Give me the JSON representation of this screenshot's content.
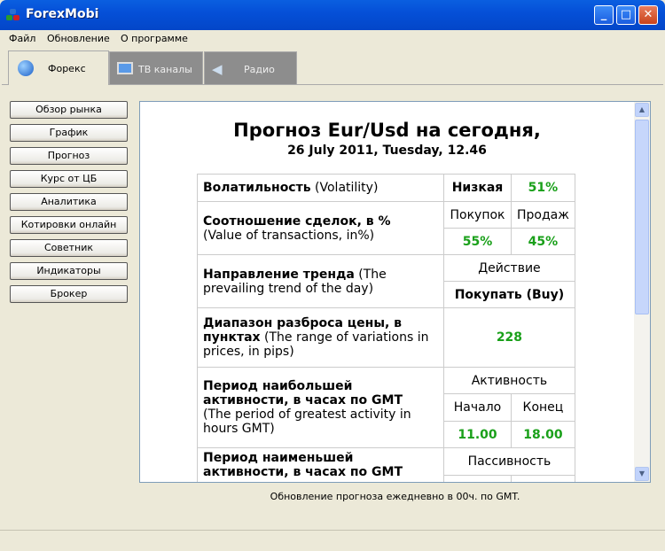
{
  "window": {
    "title": "ForexMobi",
    "minimize": "_",
    "maximize": "□",
    "close": "✕"
  },
  "menu": [
    "Файл",
    "Обновление",
    "О программе"
  ],
  "tabs": [
    {
      "label": "Форекс",
      "icon": "globe-icon"
    },
    {
      "label": "ТВ каналы",
      "icon": "monitor-icon"
    },
    {
      "label": "Радио",
      "icon": "speaker-icon"
    }
  ],
  "nav": [
    "Обзор рынка",
    "График",
    "Прогноз",
    "Курс от ЦБ",
    "Аналитика",
    "Котировки онлайн",
    "Советник",
    "Индикаторы",
    "Брокер"
  ],
  "forecast": {
    "title": "Прогноз Eur/Usd на сегодня,",
    "date": "26 July 2011, Tuesday, 12.46",
    "volatility": {
      "label": "Волатильность",
      "en": "(Volatility)",
      "level": "Низкая",
      "value": "51%"
    },
    "ratio": {
      "label": "Соотношение сделок, в %",
      "en": "(Value of transactions, in%)",
      "buy_h": "Покупок",
      "sell_h": "Продаж",
      "buy": "55%",
      "sell": "45%"
    },
    "trend": {
      "label": "Направление тренда",
      "en": "(The prevailing trend of the day)",
      "action_h": "Действие",
      "action": "Покупать (Buy)"
    },
    "range": {
      "label": "Диапазон разброса цены, в пунктах",
      "en": "(The range of variations in prices, in pips)",
      "value": "228"
    },
    "active": {
      "label": "Период наибольшей активности, в часах по GMT",
      "en": "(The period of greatest activity in hours GMT)",
      "h": "Активность",
      "start_h": "Начало",
      "end_h": "Конец",
      "start": "11.00",
      "end": "18.00"
    },
    "passive": {
      "label": "Период наименьшей активности, в часах по GMT",
      "h": "Пассивность"
    }
  },
  "caption": "Обновление прогноза ежедневно в 00ч. по GMT."
}
